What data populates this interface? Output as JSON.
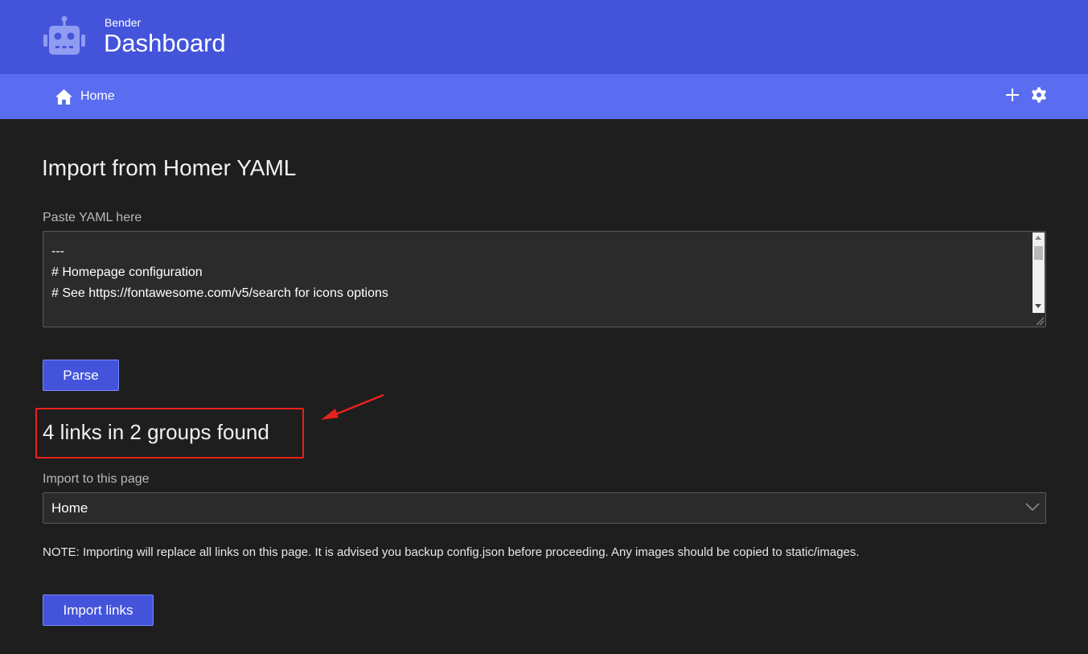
{
  "header": {
    "brand_subtitle": "Bender",
    "title": "Dashboard",
    "logo_icon": "robot-icon",
    "color": "#4454da"
  },
  "navbar": {
    "color": "#5a6cf0",
    "home_label": "Home",
    "home_icon": "home-icon",
    "add_icon": "plus-icon",
    "settings_icon": "gear-icon"
  },
  "main": {
    "heading": "Import from Homer YAML",
    "yaml_label": "Paste YAML here",
    "yaml_lines": [
      "---",
      "# Homepage configuration",
      "# See https://fontawesome.com/v5/search for icons options"
    ],
    "parse_button": "Parse",
    "result_text": "4 links in 2 groups found",
    "import_label": "Import to this page",
    "import_page_selected": "Home",
    "note": "NOTE: Importing will replace all links on this page. It is advised you backup config.json before proceeding. Any images should be copied to static/images.",
    "import_button": "Import links"
  },
  "annotation": {
    "color": "#e8221c"
  }
}
